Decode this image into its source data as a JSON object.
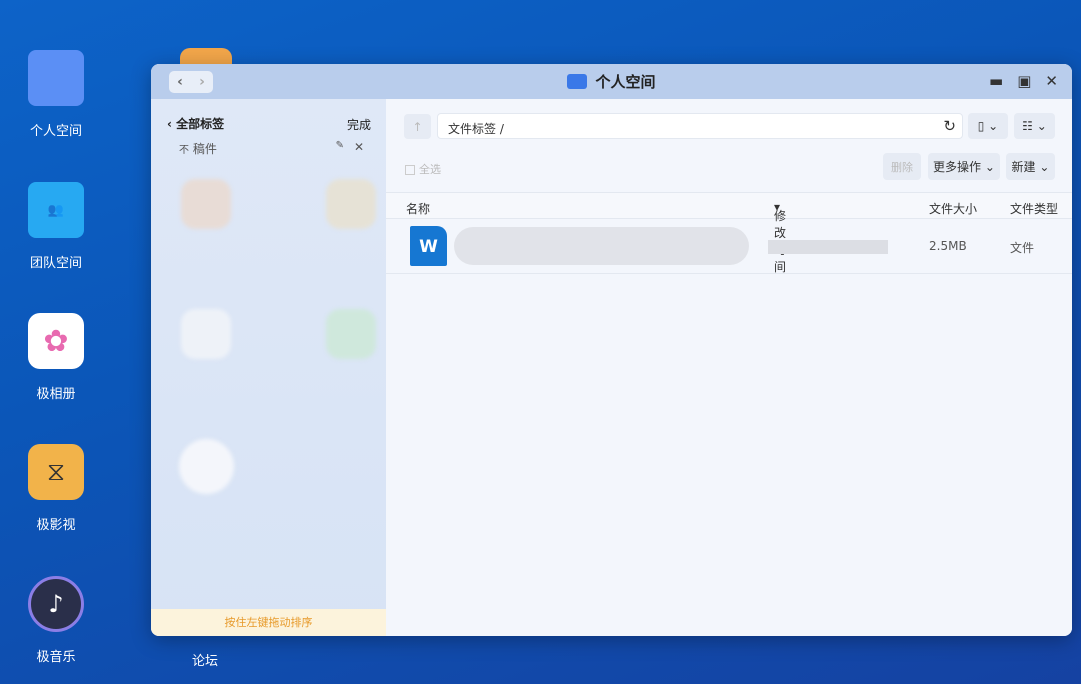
{
  "desktop": {
    "icons": [
      {
        "label": "个人空间"
      },
      {
        "label": "团队空间"
      },
      {
        "label": "极相册"
      },
      {
        "label": "极影视"
      },
      {
        "label": "极音乐"
      },
      {
        "label": "论坛"
      }
    ]
  },
  "window": {
    "title": "个人空间"
  },
  "sidebar": {
    "back_label": "全部标签",
    "done_label": "完成",
    "tag": "稿件",
    "footer": "按住左键拖动排序"
  },
  "toolbar": {
    "path": "文件标签 /",
    "select_all": "全选",
    "delete": "删除",
    "more": "更多操作",
    "new": "新建"
  },
  "table": {
    "columns": [
      "名称",
      "修改时间",
      "文件大小",
      "文件类型"
    ],
    "rows": [
      {
        "size": "2.5MB",
        "type": "文件"
      }
    ]
  },
  "colors": {
    "accent": "#1677d2",
    "footer_text": "#e79a2a"
  }
}
